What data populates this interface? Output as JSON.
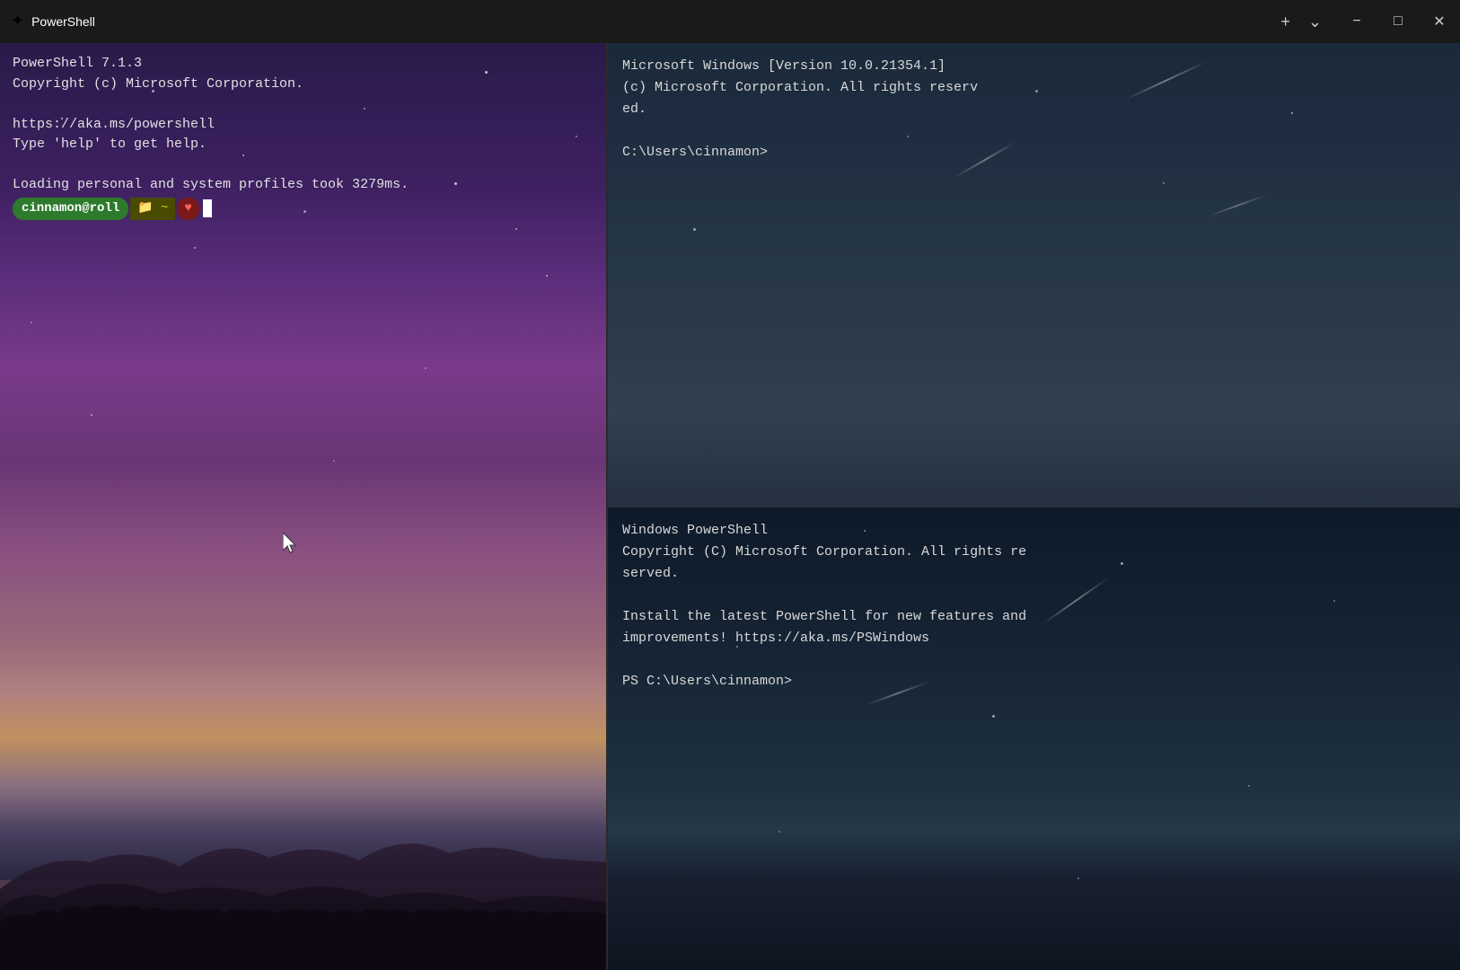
{
  "titlebar": {
    "icon": "✦",
    "title": "PowerShell",
    "plus_label": "+",
    "dropdown_label": "⌄",
    "minimize_label": "−",
    "maximize_label": "□",
    "close_label": "✕"
  },
  "left_pane": {
    "lines": [
      "PowerShell 7.1.3",
      "Copyright (c) Microsoft Corporation.",
      "",
      "https://aka.ms/powershell",
      "Type 'help' to get help.",
      "",
      "Loading personal and system profiles took 3279ms."
    ],
    "prompt_user": "cinnamon@roll",
    "prompt_folder_icon": "📁",
    "prompt_tilde": "~",
    "prompt_heart": "♥"
  },
  "right_top": {
    "lines": [
      "Microsoft Windows [Version 10.0.21354.1]",
      "(c) Microsoft Corporation. All rights reserv",
      "ed.",
      "",
      "C:\\Users\\cinnamon>"
    ]
  },
  "right_bottom": {
    "lines": [
      "Windows PowerShell",
      "Copyright (C) Microsoft Corporation. All rights re",
      "served.",
      "",
      "Install the latest PowerShell for new features and",
      " improvements! https://aka.ms/PSWindows",
      "",
      "PS C:\\Users\\cinnamon>"
    ]
  }
}
